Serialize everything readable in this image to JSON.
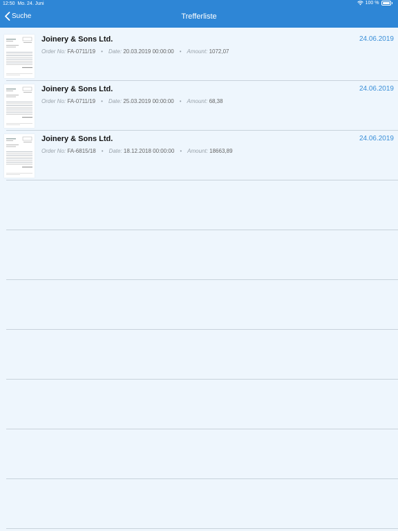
{
  "status_bar": {
    "time": "12:50",
    "date": "Mo. 24. Juni",
    "battery": "100 %",
    "battery_level": 1.0
  },
  "nav": {
    "back_label": "Suche",
    "title": "Trefferliste"
  },
  "labels": {
    "order_no": "Order No:",
    "date": "Date:",
    "amount": "Amount:",
    "separator": "•"
  },
  "results": [
    {
      "company": "Joinery & Sons Ltd.",
      "date": "24.06.2019",
      "order_no": "FA-0711/19",
      "doc_date": "20.03.2019 00:00:00",
      "amount": "1072,07"
    },
    {
      "company": "Joinery & Sons Ltd.",
      "date": "24.06.2019",
      "order_no": "FA-0711/19",
      "doc_date": "25.03.2019 00:00:00",
      "amount": "68,38"
    },
    {
      "company": "Joinery & Sons Ltd.",
      "date": "24.06.2019",
      "order_no": "FA-6815/18",
      "doc_date": "18.12.2018 00:00:00",
      "amount": "18663,89"
    }
  ],
  "empty_rows": 7,
  "colors": {
    "header": "#2e86d6",
    "background": "#eef6fd",
    "date_accent": "#3a8fd8",
    "divider": "#c8d2db"
  }
}
